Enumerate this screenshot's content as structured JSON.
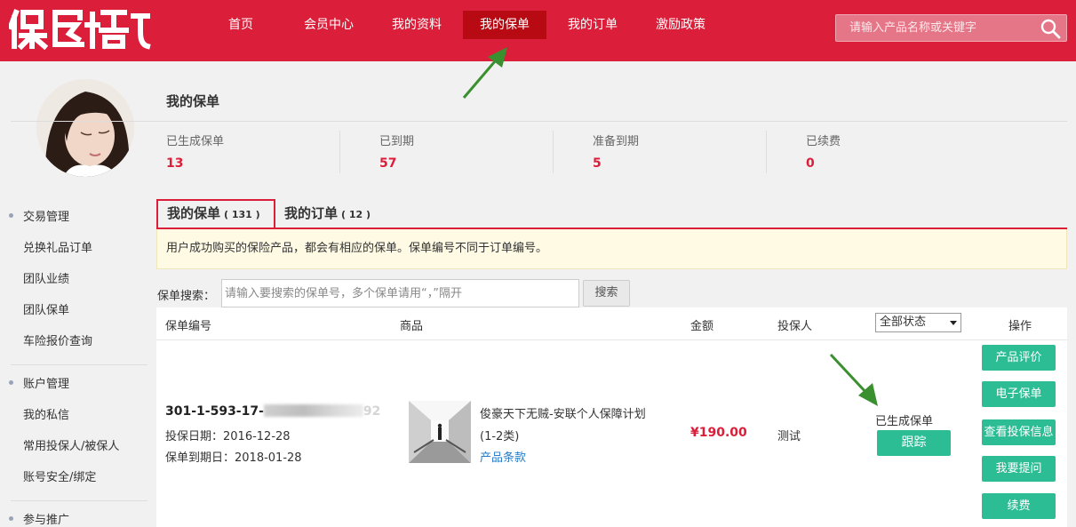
{
  "header": {
    "logo_text": "保到家",
    "nav": [
      {
        "label": "首页"
      },
      {
        "label": "会员中心"
      },
      {
        "label": "我的资料"
      },
      {
        "label": "我的保单"
      },
      {
        "label": "我的订单"
      },
      {
        "label": "激励政策"
      }
    ],
    "search_placeholder": "请输入产品名称或关键字",
    "accent_color": "#db1e39"
  },
  "summary": {
    "title": "我的保单",
    "stats": [
      {
        "label": "已生成保单",
        "value": "13"
      },
      {
        "label": "已到期",
        "value": "57"
      },
      {
        "label": "准备到期",
        "value": "5"
      },
      {
        "label": "已续费",
        "value": "0"
      }
    ]
  },
  "sidebar": {
    "groups": [
      {
        "title": "交易管理",
        "items": [
          "兑换礼品订单",
          "团队业绩",
          "团队保单",
          "车险报价查询"
        ]
      },
      {
        "title": "账户管理",
        "items": [
          "我的私信",
          "常用投保人/被保人",
          "账号安全/绑定"
        ]
      },
      {
        "title": "参与推广",
        "items": []
      }
    ]
  },
  "tabs": [
    {
      "label": "我的保单",
      "count": "( 131 )"
    },
    {
      "label": "我的订单",
      "count": "( 12 )"
    }
  ],
  "notice": "用户成功购买的保险产品，都会有相应的保单。保单编号不同于订单编号。",
  "policy_search": {
    "label": "保单搜索：",
    "placeholder": "请输入要搜索的保单号，多个保单请用“，”隔开",
    "button": "搜索"
  },
  "table": {
    "columns": [
      "保单编号",
      "商品",
      "金额",
      "投保人",
      "操作"
    ],
    "status_filter": "全部状态",
    "rows": [
      {
        "policy_no_prefix": "301-1-593-17-",
        "policy_no_suffix": "92",
        "start_date": "投保日期：2016-12-28",
        "end_date": "保单到期日：2018-01-28",
        "product_name": "俊豪天下无贼-安联个人保障计划(1-2类)",
        "product_link": "产品条款",
        "amount": "¥190.00",
        "insured": "测试",
        "status": "已生成保单",
        "track": "跟踪",
        "actions": [
          "产品评价",
          "电子保单",
          "查看投保信息",
          "我要提问",
          "续费"
        ]
      }
    ]
  }
}
